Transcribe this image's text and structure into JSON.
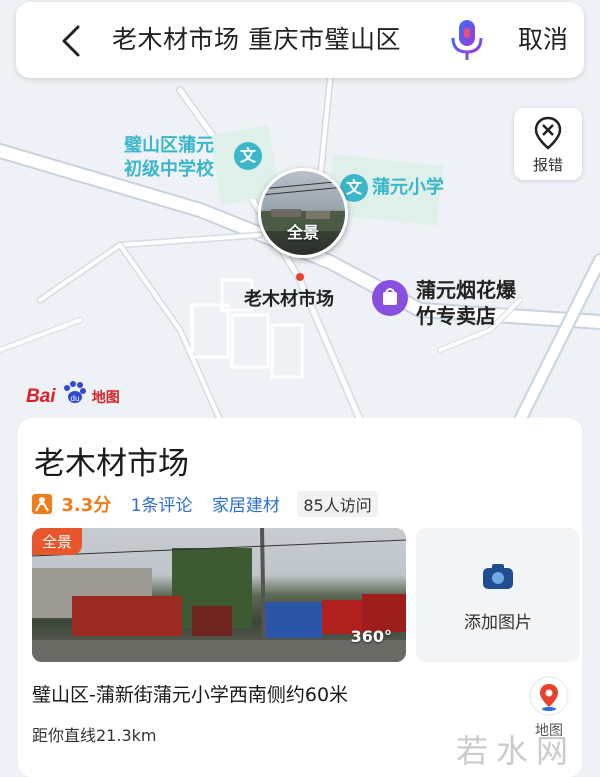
{
  "search": {
    "query": "老木材市场 重庆市璧山区",
    "cancel_label": "取消"
  },
  "map": {
    "report_label": "报错",
    "school_label_line1": "璧山区蒲元",
    "school_label_line2": "初级中学校",
    "school2_label": "蒲元小学",
    "edu_icon_glyph": "文",
    "market_label": "老木材市场",
    "shop_label_line1": "蒲元烟花爆",
    "shop_label_line2": "竹专卖店",
    "panorama_label": "全景",
    "logo_bai": "Bai",
    "logo_map": "地图"
  },
  "card": {
    "name": "老木材市场",
    "rating": "3.3分",
    "reviews": "1条评论",
    "category": "家居建材",
    "visits": "85人访问",
    "photo_tag": "全景",
    "photo_360": "360°",
    "add_photo_label": "添加图片",
    "address": "璧山区-蒲新街蒲元小学西南侧约60米",
    "distance": "距你直线21.3km",
    "map_button_label": "地图"
  },
  "watermark": "若水网",
  "colors": {
    "accent_blue": "#2f6fd4",
    "rating_orange": "#f07b1c",
    "school_teal": "#3bb7c9",
    "shop_purple": "#8a4fe0",
    "panorama_tag": "#e8562b",
    "brand_red": "#d8232a"
  }
}
